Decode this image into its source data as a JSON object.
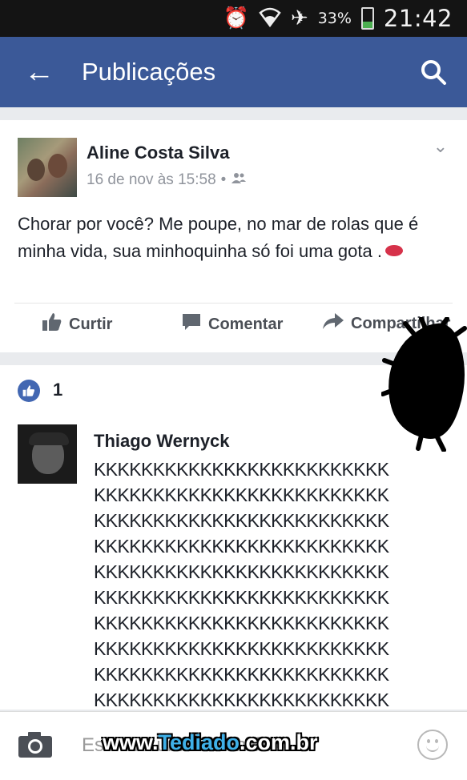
{
  "status_bar": {
    "icons": [
      "alarm-icon",
      "wifi-icon",
      "airplane-icon"
    ],
    "battery_percent": "33%",
    "battery_level": 0.33,
    "time": "21:42"
  },
  "app_bar": {
    "title": "Publicações",
    "back_icon": "arrow-left-icon",
    "search_icon": "search-icon",
    "color": "#3b5998"
  },
  "post": {
    "author": "Aline Costa Silva",
    "timestamp": "16 de nov às 15:58",
    "privacy_icon": "friends-icon",
    "text": "Chorar por você? Me poupe, no mar de rolas que é minha vida, sua minhoquinha só foi uma gota .",
    "emoji": "lips-emoji",
    "actions": {
      "like": "Curtir",
      "comment": "Comentar",
      "share": "Compartilhar"
    }
  },
  "reactions": {
    "icon": "like-reaction-icon",
    "count": "1"
  },
  "comment": {
    "author": "Thiago Wernyck",
    "lines": [
      "KKKKKKKKKKKKKKKKKKKKKKKKK",
      "KKKKKKKKKKKKKKKKKKKKKKKKK",
      "KKKKKKKKKKKKKKKKKKKKKKKKK",
      "KKKKKKKKKKKKKKKKKKKKKKKKK",
      "KKKKKKKKKKKKKKKKKKKKKKKKK",
      "KKKKKKKKKKKKKKKKKKKKKKKKK",
      "KKKKKKKKKKKKKKKKKKKKKKKKK",
      "KKKKKKKKKKKKKKKKKKKKKKKKK",
      "KKKKKKKKKKKKKKKKKKKKKKKKK",
      "KKKKKKKKKKKKKKKKKKKKKKKKK"
    ]
  },
  "composer": {
    "placeholder": "Escreva um comentário...",
    "camera_icon": "camera-icon",
    "emoji_icon": "smiley-icon"
  },
  "watermark": {
    "prefix": "www.",
    "brand": "Tediado",
    "suffix": ".com.br"
  }
}
